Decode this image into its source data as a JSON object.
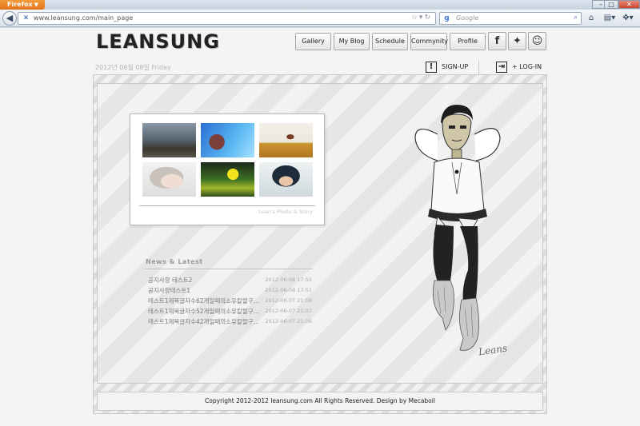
{
  "browser": {
    "menu_label": "Firefox",
    "url": "www.leansung.com/main_page",
    "search_placeholder": "Google"
  },
  "site": {
    "logo": "LEANSUNG",
    "date": "2012년 06월 08일 Friday",
    "nav": [
      "Gallery",
      "My Blog",
      "Schedule",
      "Commynity",
      "Profile"
    ],
    "social": [
      "facebook-icon",
      "twitter-icon",
      "smiley-icon"
    ],
    "signup_label": "SIGN-UP",
    "login_label": "+ LOG-IN",
    "gallery_caption": "Lean's Photo & Story",
    "news_title": "News & Latest",
    "news": [
      {
        "title": "공지사항 테스트2",
        "date": "2012-06-08 17:55"
      },
      {
        "title": "공지사항테스트1",
        "date": "2012-06-08 17:51"
      },
      {
        "title": "테스트1제목글자수62개일때의소유칼랄구...",
        "date": "2012-06-07 21:08"
      },
      {
        "title": "테스트1제목글자수52개일때의소유칼랄구...",
        "date": "2012-06-07 21:07"
      },
      {
        "title": "테스트1제목글자수42개일때의소유칼랄구...",
        "date": "2012-06-07 21:06"
      }
    ],
    "signature": "Leans",
    "footer": "Copyright 2012-2012 leansung.com All Rights Reserved.     Design by Mecaboil"
  }
}
